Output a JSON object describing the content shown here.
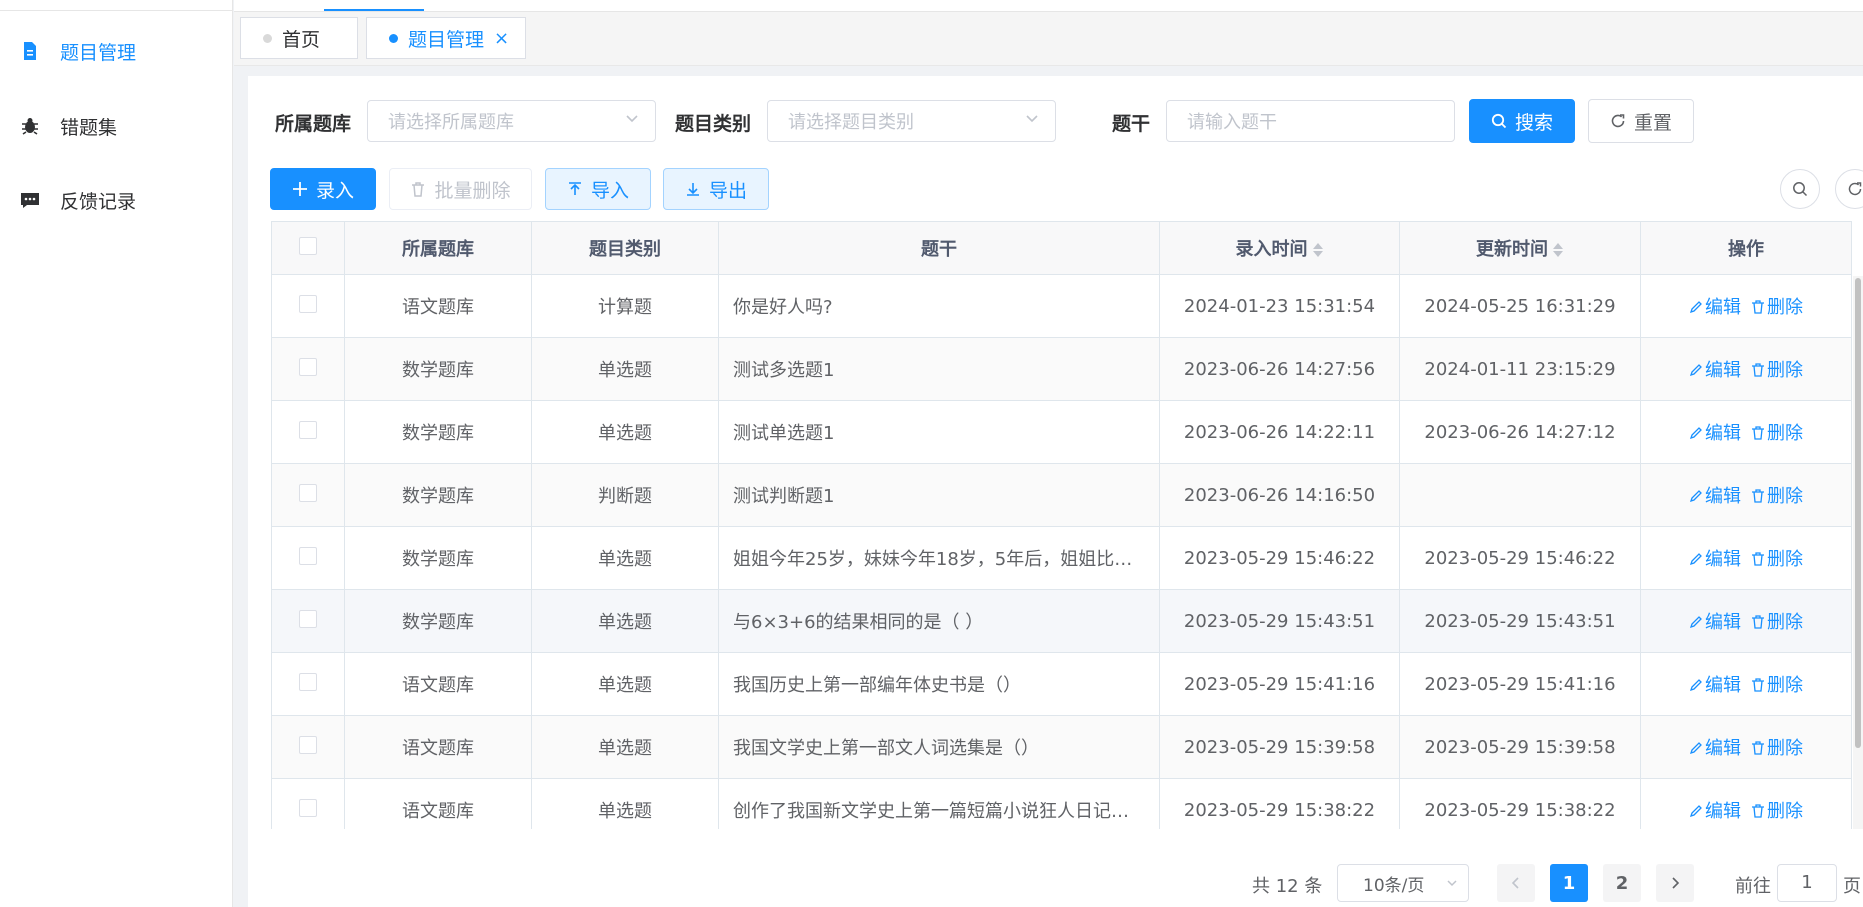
{
  "sidebar": {
    "items": [
      {
        "label": "题目管理",
        "icon": "document-icon",
        "active": true
      },
      {
        "label": "错题集",
        "icon": "bug-icon",
        "active": false
      },
      {
        "label": "反馈记录",
        "icon": "message-icon",
        "active": false
      }
    ]
  },
  "tabs": [
    {
      "label": "首页",
      "active": false
    },
    {
      "label": "题目管理",
      "active": true,
      "close": "×"
    }
  ],
  "search": {
    "bank_label": "所属题库",
    "bank_placeholder": "请选择所属题库",
    "type_label": "题目类别",
    "type_placeholder": "请选择题目类别",
    "stem_label": "题干",
    "stem_placeholder": "请输入题干",
    "search_button": "搜索",
    "reset_button": "重置"
  },
  "toolbar": {
    "add": "录入",
    "batch_delete": "批量删除",
    "import": "导入",
    "export": "导出"
  },
  "table": {
    "headers": [
      "所属题库",
      "题目类别",
      "题干",
      "录入时间",
      "更新时间",
      "操作"
    ],
    "edit_label": "编辑",
    "delete_label": "删除",
    "rows": [
      [
        "语文题库",
        "计算题",
        "你是好人吗?",
        "2024-01-23 15:31:54",
        "2024-05-25 16:31:29"
      ],
      [
        "数学题库",
        "单选题",
        "测试多选题1",
        "2023-06-26 14:27:56",
        "2024-01-11 23:15:29"
      ],
      [
        "数学题库",
        "单选题",
        "测试单选题1",
        "2023-06-26 14:22:11",
        "2023-06-26 14:27:12"
      ],
      [
        "数学题库",
        "判断题",
        "测试判断题1",
        "2023-06-26 14:16:50",
        ""
      ],
      [
        "数学题库",
        "单选题",
        "姐姐今年25岁，妹妹今年18岁，5年后，姐姐比…",
        "2023-05-29 15:46:22",
        "2023-05-29 15:46:22"
      ],
      [
        "数学题库",
        "单选题",
        "与6×3+6的结果相同的是（ ）",
        "2023-05-29 15:43:51",
        "2023-05-29 15:43:51"
      ],
      [
        "语文题库",
        "单选题",
        "我国历史上第一部编年体史书是（）",
        "2023-05-29 15:41:16",
        "2023-05-29 15:41:16"
      ],
      [
        "语文题库",
        "单选题",
        "我国文学史上第一部文人词选集是（）",
        "2023-05-29 15:39:58",
        "2023-05-29 15:39:58"
      ],
      [
        "语文题库",
        "单选题",
        "创作了我国新文学史上第一篇短篇小说狂人日记…",
        "2023-05-29 15:38:22",
        "2023-05-29 15:38:22"
      ]
    ]
  },
  "pagination": {
    "total": "共 12 条",
    "page_size": "10条/页",
    "pages": [
      "1",
      "2"
    ],
    "current": "1",
    "goto_prefix": "前往",
    "goto_value": "1",
    "goto_suffix": "页"
  },
  "colors": {
    "primary": "#1890ff",
    "border": "#dcdfe6"
  }
}
